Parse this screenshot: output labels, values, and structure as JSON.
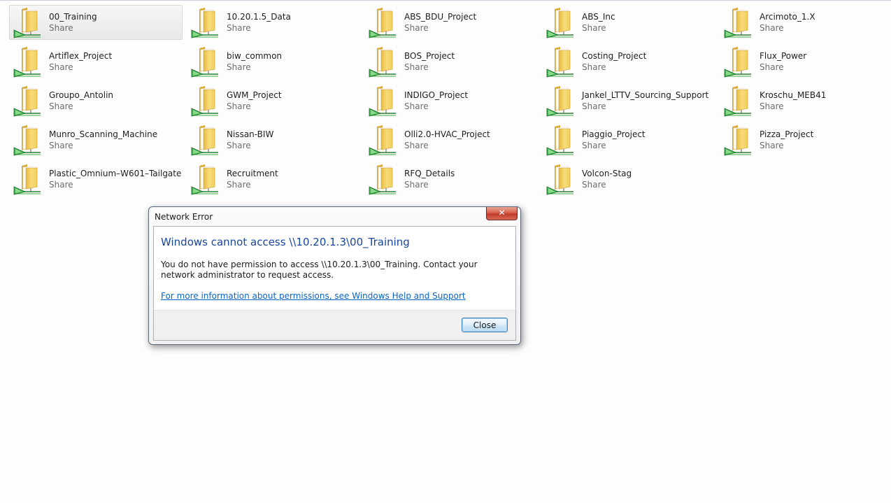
{
  "shares": [
    {
      "name": "00_Training",
      "type": "Share",
      "selected": true
    },
    {
      "name": "10.20.1.5_Data",
      "type": "Share"
    },
    {
      "name": "ABS_BDU_Project",
      "type": "Share"
    },
    {
      "name": "ABS_Inc",
      "type": "Share"
    },
    {
      "name": "Arcimoto_1.X",
      "type": "Share"
    },
    {
      "name": "Artiflex_Project",
      "type": "Share"
    },
    {
      "name": "biw_common",
      "type": "Share"
    },
    {
      "name": "BOS_Project",
      "type": "Share"
    },
    {
      "name": "Costing_Project",
      "type": "Share"
    },
    {
      "name": "Flux_Power",
      "type": "Share"
    },
    {
      "name": "Groupo_Antolin",
      "type": "Share"
    },
    {
      "name": "GWM_Project",
      "type": "Share"
    },
    {
      "name": "INDIGO_Project",
      "type": "Share"
    },
    {
      "name": "Jankel_LTTV_Sourcing_Support",
      "type": "Share"
    },
    {
      "name": "Kroschu_MEB41",
      "type": "Share"
    },
    {
      "name": "Munro_Scanning_Machine",
      "type": "Share"
    },
    {
      "name": "Nissan-BIW",
      "type": "Share"
    },
    {
      "name": "Olli2.0-HVAC_Project",
      "type": "Share"
    },
    {
      "name": "Piaggio_Project",
      "type": "Share"
    },
    {
      "name": "Pizza_Project",
      "type": "Share"
    },
    {
      "name": "Plastic_Omnium–W601–Tailgate",
      "type": "Share"
    },
    {
      "name": "Recruitment",
      "type": "Share"
    },
    {
      "name": "RFQ_Details",
      "type": "Share"
    },
    {
      "name": "Volcon-Stag",
      "type": "Share"
    }
  ],
  "icons": {
    "share": "network-share-folder-icon",
    "close": "close-x-icon"
  },
  "dialog": {
    "title": "Network Error",
    "close_glyph": "✕",
    "main_instruction": "Windows cannot access \\\\10.20.1.3\\00_Training",
    "message": "You do not have permission to access \\\\10.20.1.3\\00_Training. Contact your network administrator to request access.",
    "help_link": "For more information about permissions, see Windows Help and Support",
    "close_button": "Close"
  },
  "colors": {
    "accent_text": "#16479f",
    "link": "#0a63c9",
    "close_red": "#c0392b",
    "folder_yellow": "#f2cf63",
    "network_green": "#3cb04a"
  }
}
